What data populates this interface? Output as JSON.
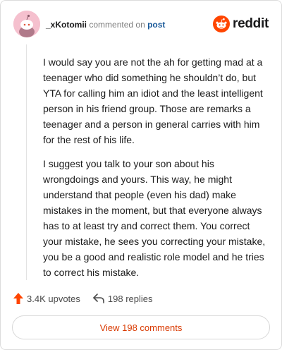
{
  "header": {
    "username": "_xKotomii",
    "commented_on": "commented on",
    "post_link": "post",
    "brand": "reddit"
  },
  "comment": {
    "paragraphs": [
      "I would say you are not the ah for getting mad at a teenager who did something he shouldn’t do, but YTA for calling him an idiot and the least intelligent person in his friend group. Those are remarks a teenager and a person in general carries with him for the rest of his life.",
      "I suggest you talk to your son about his wrongdoings and yours. This way, he might understand that people (even his dad) make mistakes in the moment, but that everyone always has to at least try and correct them. You correct your mistake, he sees you correcting your mistake, you be a good and realistic role model and he tries to correct his mistake."
    ]
  },
  "actions": {
    "upvotes_label": "3.4K upvotes",
    "replies_label": "198 replies"
  },
  "footer": {
    "view_comments_label": "View 198 comments"
  },
  "colors": {
    "brand_orange": "#ff4500",
    "link_blue": "#1a5a9a",
    "button_text": "#d93900"
  }
}
